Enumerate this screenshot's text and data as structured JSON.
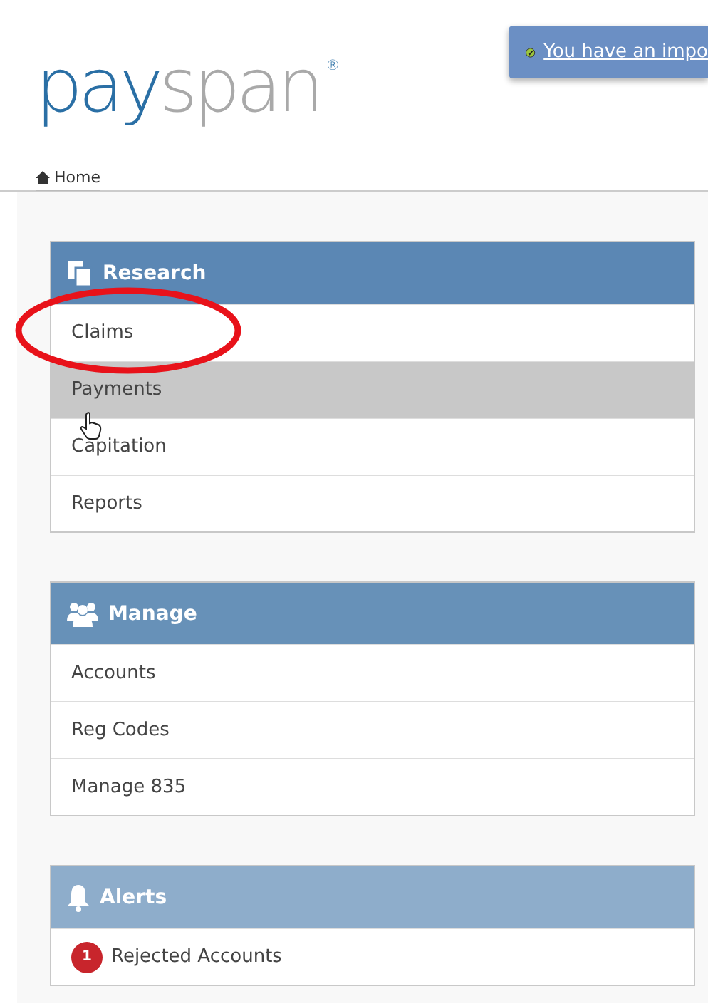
{
  "logo": {
    "first": "pay",
    "second": "span",
    "mark": "®"
  },
  "notice": {
    "text": "You have an impo"
  },
  "breadcrumb": {
    "label": "Home"
  },
  "panels": [
    {
      "title": "Research",
      "kind": "documents",
      "color": "#5b87b4",
      "items": [
        {
          "label": "Claims",
          "hovered": false,
          "circled": true
        },
        {
          "label": "Payments",
          "hovered": true,
          "circled": false
        },
        {
          "label": "Capitation",
          "hovered": false,
          "circled": false
        },
        {
          "label": "Reports",
          "hovered": false,
          "circled": false
        }
      ]
    },
    {
      "title": "Manage",
      "kind": "users",
      "color": "#6791b8",
      "items": [
        {
          "label": "Accounts",
          "hovered": false,
          "circled": false
        },
        {
          "label": "Reg Codes",
          "hovered": false,
          "circled": false
        },
        {
          "label": "Manage 835",
          "hovered": false,
          "circled": false
        }
      ]
    },
    {
      "title": "Alerts",
      "kind": "bell",
      "color": "#8eadcb",
      "items": [
        {
          "label": "Rejected Accounts",
          "badge": "1",
          "hovered": false,
          "circled": false
        }
      ]
    }
  ]
}
